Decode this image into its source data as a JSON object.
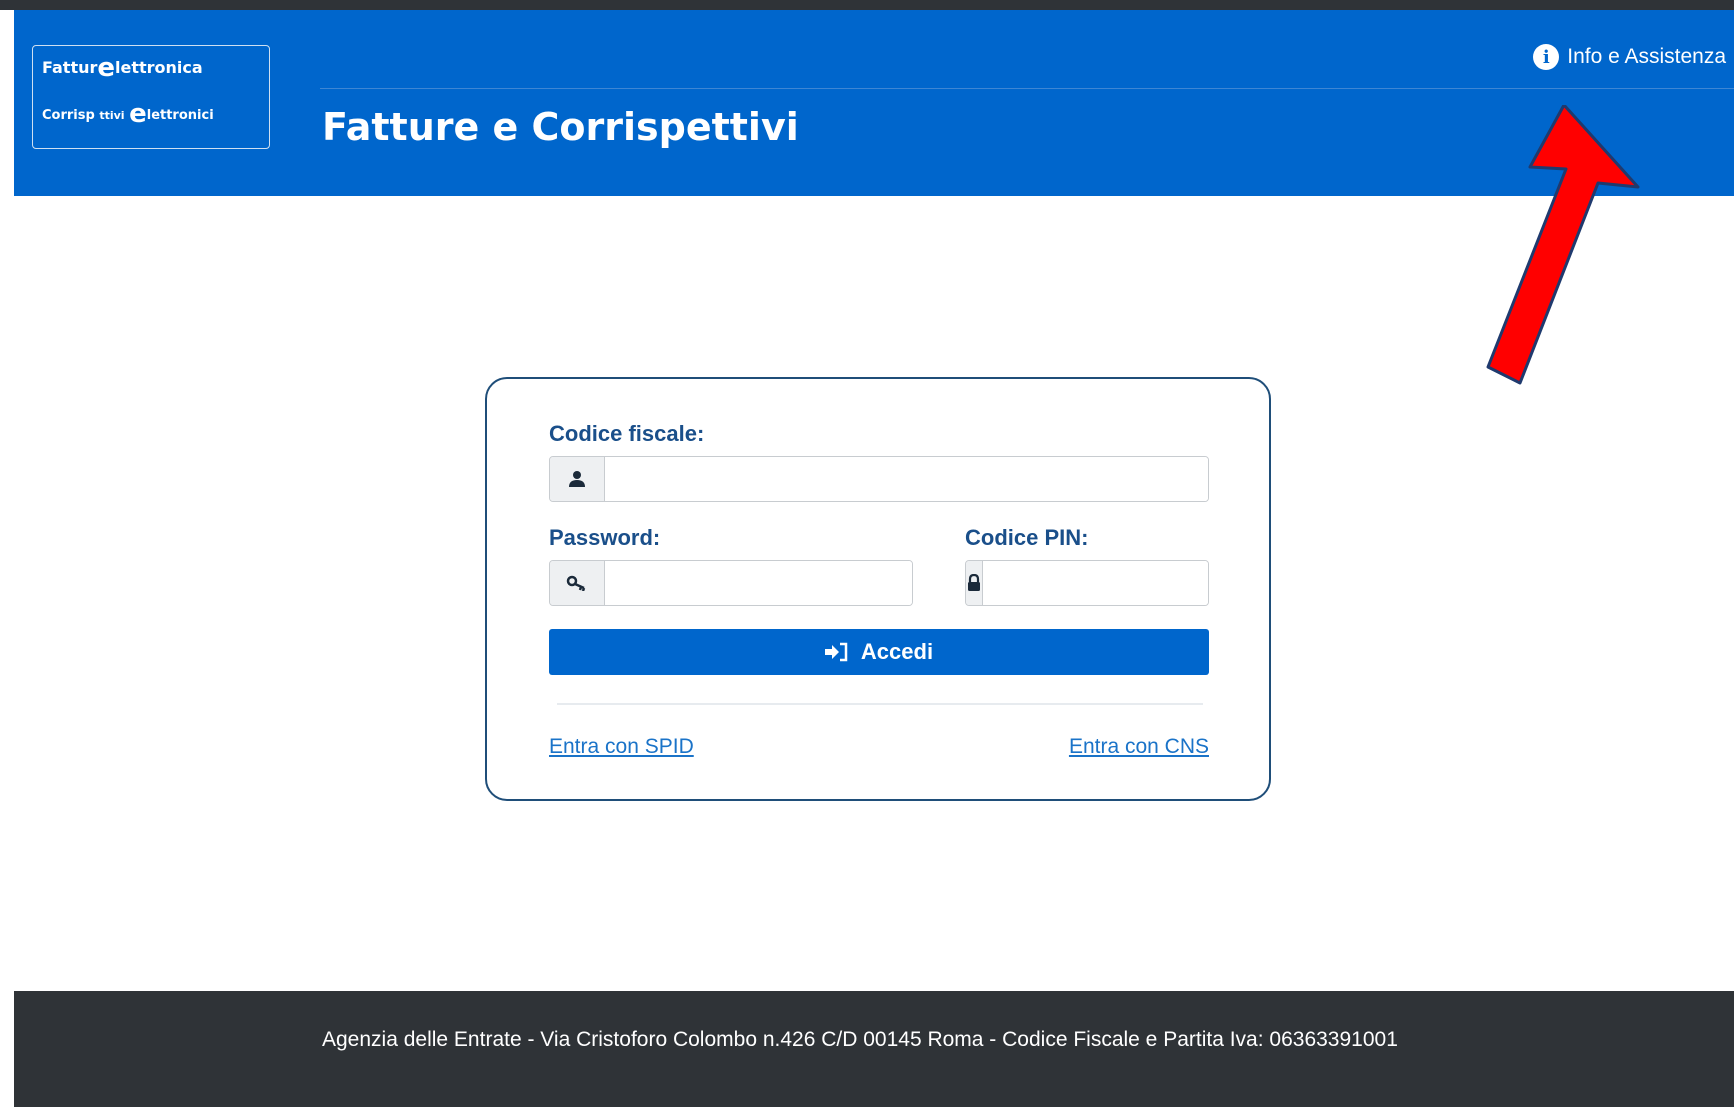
{
  "header": {
    "logo": {
      "line1_a": "Fattur",
      "line1_b": "lettronica",
      "line2_a": "Corrisp",
      "line2_b": "ttivi",
      "line2_c": "lettronici",
      "e_glyph": "e"
    },
    "title": "Fatture e Corrispettivi",
    "info_link": "Info e Assistenza",
    "info_icon": "info-circle-icon"
  },
  "annotation": {
    "color": "#ff0000",
    "outline": "#1f3a6e"
  },
  "login": {
    "codice_fiscale_label": "Codice fiscale:",
    "codice_fiscale_value": "",
    "codice_fiscale_icon": "user-icon",
    "password_label": "Password:",
    "password_value": "",
    "password_icon": "key-icon",
    "pin_label": "Codice PIN:",
    "pin_value": "",
    "pin_icon": "lock-icon",
    "submit_label": "Accedi",
    "submit_icon": "sign-in-icon",
    "spid_link": "Entra con SPID",
    "cns_link": "Entra con CNS"
  },
  "footer": {
    "text": "Agenzia delle Entrate - Via Cristoforo Colombo n.426 C/D 00145 Roma - Codice Fiscale e Partita Iva: 06363391001"
  },
  "colors": {
    "brand_blue": "#0066cc",
    "dark": "#2f3337",
    "label_blue": "#1a4f8a",
    "link_blue": "#1a73c8"
  }
}
